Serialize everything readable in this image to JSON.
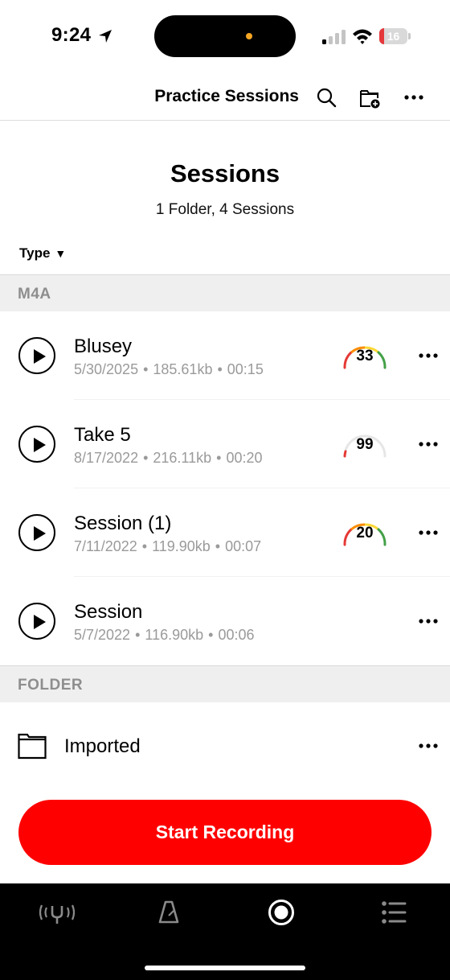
{
  "status_bar": {
    "time": "9:24",
    "battery_level": "16",
    "battery_fraction": 0.16,
    "icons": [
      "location-arrow-icon",
      "cellular-signal-icon",
      "wifi-icon",
      "battery-icon"
    ]
  },
  "nav": {
    "title": "Practice Sessions",
    "actions": [
      "search-icon",
      "new-folder-icon",
      "more-icon"
    ]
  },
  "header": {
    "title": "Sessions",
    "subtitle": "1 Folder, 4 Sessions"
  },
  "sort": {
    "label": "Type",
    "indicator": "▼"
  },
  "sections": [
    {
      "label": "M4A",
      "sessions": [
        {
          "title": "Blusey",
          "date": "5/30/2025",
          "size": "185.61kb",
          "duration": "00:15",
          "score": "33",
          "gauge_style": "colored"
        },
        {
          "title": "Take 5",
          "date": "8/17/2022",
          "size": "216.11kb",
          "duration": "00:20",
          "score": "99",
          "gauge_style": "gray"
        },
        {
          "title": "Session (1)",
          "date": "7/11/2022",
          "size": "119.90kb",
          "duration": "00:07",
          "score": "20",
          "gauge_style": "colored"
        },
        {
          "title": "Session",
          "date": "5/7/2022",
          "size": "116.90kb",
          "duration": "00:06",
          "score": "",
          "gauge_style": "none"
        }
      ]
    },
    {
      "label": "FOLDER",
      "folders": [
        {
          "name": "Imported"
        }
      ]
    }
  ],
  "separator": "•",
  "record_button": {
    "label": "Start Recording"
  },
  "colors": {
    "accent": "#ff0000",
    "section_bg": "#efefef",
    "section_text": "#8e8e8e",
    "meta_text": "#9a9a9a",
    "tab_bar": "#000000"
  },
  "tab_bar": {
    "tabs": [
      "tuner-icon",
      "metronome-icon",
      "record-icon",
      "list-icon"
    ]
  }
}
